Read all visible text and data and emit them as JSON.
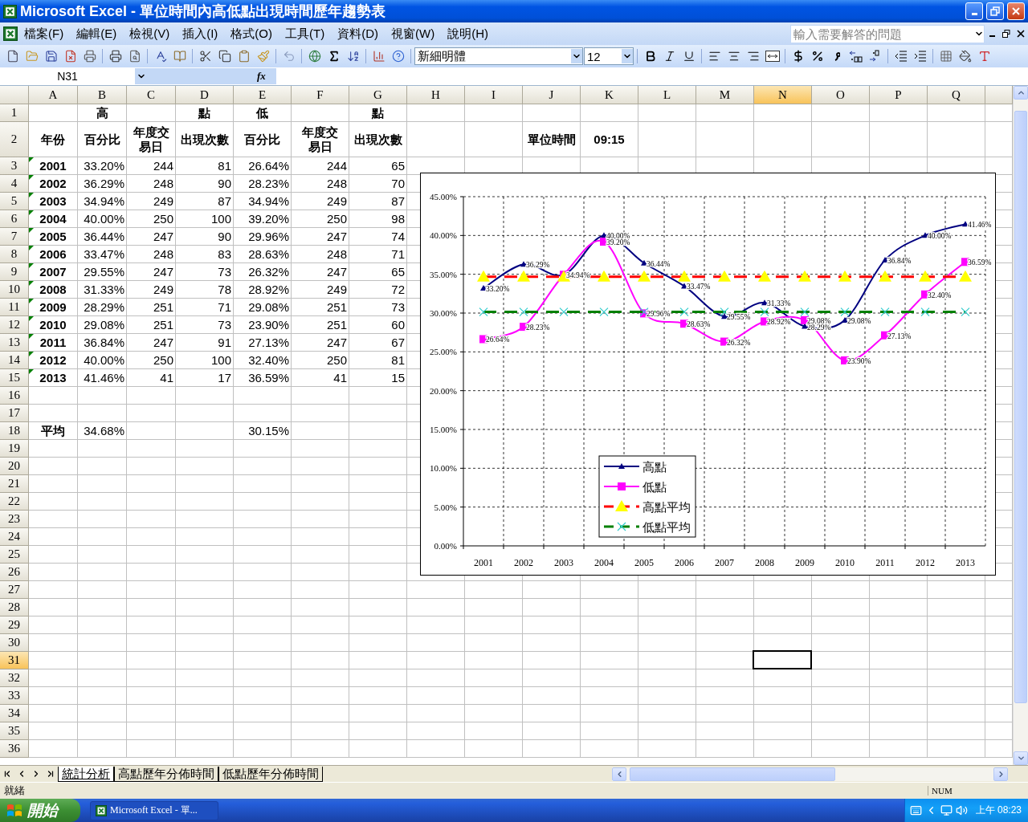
{
  "window": {
    "title": "Microsoft Excel - 單位時間內高低點出現時間歷年趨勢表"
  },
  "menu_bar": {
    "items": [
      "檔案(F)",
      "編輯(E)",
      "檢視(V)",
      "插入(I)",
      "格式(O)",
      "工具(T)",
      "資料(D)",
      "視窗(W)",
      "說明(H)"
    ],
    "help_box": {
      "placeholder": "輸入需要解答的問題"
    }
  },
  "formatting_toolbar": {
    "font": "新細明體",
    "font_size": "12"
  },
  "formula_bar": {
    "name_box": "N31",
    "function_label": "fx"
  },
  "sheet": {
    "columns": [
      {
        "label": "A",
        "selected": false
      },
      {
        "label": "B",
        "selected": false
      },
      {
        "label": "C",
        "selected": false
      },
      {
        "label": "D",
        "selected": false
      },
      {
        "label": "E",
        "selected": false
      },
      {
        "label": "F",
        "selected": false
      },
      {
        "label": "G",
        "selected": false
      },
      {
        "label": "H",
        "selected": false
      },
      {
        "label": "I",
        "selected": false
      },
      {
        "label": "J",
        "selected": false
      },
      {
        "label": "K",
        "selected": false
      },
      {
        "label": "L",
        "selected": false
      },
      {
        "label": "M",
        "selected": false
      },
      {
        "label": "N",
        "selected": true
      },
      {
        "label": "O",
        "selected": false
      },
      {
        "label": "P",
        "selected": false
      },
      {
        "label": "Q",
        "selected": false
      }
    ],
    "rows": [
      {
        "number": "1",
        "selected": false,
        "error_indicator": false,
        "cells": [
          null,
          "高",
          null,
          "點",
          "低",
          null,
          "點"
        ]
      },
      {
        "number": "2",
        "selected": false,
        "error_indicator": false,
        "cells": [
          "年份",
          "百分比",
          "年度交易日",
          "出現次數",
          "百分比",
          "年度交易日",
          "出現次數",
          null,
          null,
          "單位時間",
          "09:15"
        ]
      },
      {
        "number": "3",
        "selected": false,
        "error_indicator": true,
        "cells": [
          "2001",
          "33.20%",
          "244",
          "81",
          "26.64%",
          "244",
          "65"
        ]
      },
      {
        "number": "4",
        "selected": false,
        "error_indicator": true,
        "cells": [
          "2002",
          "36.29%",
          "248",
          "90",
          "28.23%",
          "248",
          "70"
        ]
      },
      {
        "number": "5",
        "selected": false,
        "error_indicator": true,
        "cells": [
          "2003",
          "34.94%",
          "249",
          "87",
          "34.94%",
          "249",
          "87"
        ]
      },
      {
        "number": "6",
        "selected": false,
        "error_indicator": true,
        "cells": [
          "2004",
          "40.00%",
          "250",
          "100",
          "39.20%",
          "250",
          "98"
        ]
      },
      {
        "number": "7",
        "selected": false,
        "error_indicator": true,
        "cells": [
          "2005",
          "36.44%",
          "247",
          "90",
          "29.96%",
          "247",
          "74"
        ]
      },
      {
        "number": "8",
        "selected": false,
        "error_indicator": true,
        "cells": [
          "2006",
          "33.47%",
          "248",
          "83",
          "28.63%",
          "248",
          "71"
        ]
      },
      {
        "number": "9",
        "selected": false,
        "error_indicator": true,
        "cells": [
          "2007",
          "29.55%",
          "247",
          "73",
          "26.32%",
          "247",
          "65"
        ]
      },
      {
        "number": "10",
        "selected": false,
        "error_indicator": true,
        "cells": [
          "2008",
          "31.33%",
          "249",
          "78",
          "28.92%",
          "249",
          "72"
        ]
      },
      {
        "number": "11",
        "selected": false,
        "error_indicator": true,
        "cells": [
          "2009",
          "28.29%",
          "251",
          "71",
          "29.08%",
          "251",
          "73"
        ]
      },
      {
        "number": "12",
        "selected": false,
        "error_indicator": true,
        "cells": [
          "2010",
          "29.08%",
          "251",
          "73",
          "23.90%",
          "251",
          "60"
        ]
      },
      {
        "number": "13",
        "selected": false,
        "error_indicator": true,
        "cells": [
          "2011",
          "36.84%",
          "247",
          "91",
          "27.13%",
          "247",
          "67"
        ]
      },
      {
        "number": "14",
        "selected": false,
        "error_indicator": true,
        "cells": [
          "2012",
          "40.00%",
          "250",
          "100",
          "32.40%",
          "250",
          "81"
        ]
      },
      {
        "number": "15",
        "selected": false,
        "error_indicator": true,
        "cells": [
          "2013",
          "41.46%",
          "41",
          "17",
          "36.59%",
          "41",
          "15"
        ]
      },
      {
        "number": "16",
        "selected": false,
        "error_indicator": false,
        "cells": []
      },
      {
        "number": "17",
        "selected": false,
        "error_indicator": false,
        "cells": []
      },
      {
        "number": "18",
        "selected": false,
        "error_indicator": false,
        "cells": [
          "平均",
          "34.68%",
          null,
          null,
          "30.15%"
        ]
      },
      {
        "number": "19",
        "selected": false,
        "error_indicator": false,
        "cells": []
      },
      {
        "number": "20",
        "selected": false,
        "error_indicator": false,
        "cells": []
      },
      {
        "number": "21",
        "selected": false,
        "error_indicator": false,
        "cells": []
      },
      {
        "number": "22",
        "selected": false,
        "error_indicator": false,
        "cells": []
      },
      {
        "number": "23",
        "selected": false,
        "error_indicator": false,
        "cells": []
      },
      {
        "number": "24",
        "selected": false,
        "error_indicator": false,
        "cells": []
      },
      {
        "number": "25",
        "selected": false,
        "error_indicator": false,
        "cells": []
      },
      {
        "number": "26",
        "selected": false,
        "error_indicator": false,
        "cells": []
      },
      {
        "number": "27",
        "selected": false,
        "error_indicator": false,
        "cells": []
      },
      {
        "number": "28",
        "selected": false,
        "error_indicator": false,
        "cells": []
      },
      {
        "number": "29",
        "selected": false,
        "error_indicator": false,
        "cells": []
      },
      {
        "number": "30",
        "selected": false,
        "error_indicator": false,
        "cells": []
      },
      {
        "number": "31",
        "selected": true,
        "error_indicator": false,
        "cells": []
      },
      {
        "number": "32",
        "selected": false,
        "error_indicator": false,
        "cells": []
      },
      {
        "number": "33",
        "selected": false,
        "error_indicator": false,
        "cells": []
      },
      {
        "number": "34",
        "selected": false,
        "error_indicator": false,
        "cells": []
      },
      {
        "number": "35",
        "selected": false,
        "error_indicator": false,
        "cells": []
      },
      {
        "number": "36",
        "selected": false,
        "error_indicator": false,
        "cells": []
      }
    ]
  },
  "chart": {
    "chart_data": {
      "type": "line",
      "categories": [
        "2001",
        "2002",
        "2003",
        "2004",
        "2005",
        "2006",
        "2007",
        "2008",
        "2009",
        "2010",
        "2011",
        "2012",
        "2013"
      ],
      "ylim": [
        0,
        45
      ],
      "yticks": [
        {
          "value": 0,
          "label": "0.00%"
        },
        {
          "value": 5,
          "label": "5.00%"
        },
        {
          "value": 10,
          "label": "10.00%"
        },
        {
          "value": 15,
          "label": "15.00%"
        },
        {
          "value": 20,
          "label": "20.00%"
        },
        {
          "value": 25,
          "label": "25.00%"
        },
        {
          "value": 30,
          "label": "30.00%"
        },
        {
          "value": 35,
          "label": "35.00%"
        },
        {
          "value": 40,
          "label": "40.00%"
        },
        {
          "value": 45,
          "label": "45.00%"
        }
      ],
      "grid": true,
      "legend": true,
      "series": [
        {
          "name": "高點",
          "color": "#000080",
          "marker": "triangle",
          "line_style": "solid",
          "values": [
            33.2,
            36.29,
            34.94,
            40.0,
            36.44,
            33.47,
            29.55,
            31.33,
            28.29,
            29.08,
            36.84,
            40.0,
            41.46
          ],
          "value_labels": [
            "33.20%",
            "36.29%",
            null,
            "40.00%",
            "36.44%",
            "33.47%",
            "29.55%",
            "31.33%",
            "28.29%",
            "29.08%",
            "36.84%",
            "40.00%",
            "41.46%"
          ]
        },
        {
          "name": "低點",
          "color": "#ff00ff",
          "marker": "square",
          "line_style": "solid",
          "values": [
            26.64,
            28.23,
            34.94,
            39.2,
            29.96,
            28.63,
            26.32,
            28.92,
            29.08,
            23.9,
            27.13,
            32.4,
            36.59
          ],
          "value_labels": [
            "26.64%",
            "28.23%",
            "34.94%",
            "39.20%",
            "29.96%",
            "28.63%",
            "26.32%",
            "28.92%",
            "29.08%",
            "23.90%",
            "27.13%",
            "32.40%",
            "36.59%"
          ]
        },
        {
          "name": "高點平均",
          "color": "#ff0000",
          "marker": "triangle",
          "line_style": "dashed",
          "values": [
            34.68,
            34.68,
            34.68,
            34.68,
            34.68,
            34.68,
            34.68,
            34.68,
            34.68,
            34.68,
            34.68,
            34.68,
            34.68
          ]
        },
        {
          "name": "低點平均",
          "color": "#008000",
          "marker": "cross",
          "line_style": "dashed",
          "values": [
            30.15,
            30.15,
            30.15,
            30.15,
            30.15,
            30.15,
            30.15,
            30.15,
            30.15,
            30.15,
            30.15,
            30.15,
            30.15
          ]
        }
      ]
    }
  },
  "sheet_tabs": [
    {
      "label": "統計分析",
      "selected": true
    },
    {
      "label": "高點歷年分佈時間",
      "selected": false
    },
    {
      "label": "低點歷年分佈時間",
      "selected": false
    }
  ],
  "status_bar": {
    "status": "就緒",
    "indicators": [
      "NUM"
    ]
  },
  "taskbar": {
    "start_label": "開始",
    "tasks": [
      {
        "label": "Microsoft Excel - 單...",
        "selected": true
      }
    ],
    "clock": "上午 08:23"
  }
}
